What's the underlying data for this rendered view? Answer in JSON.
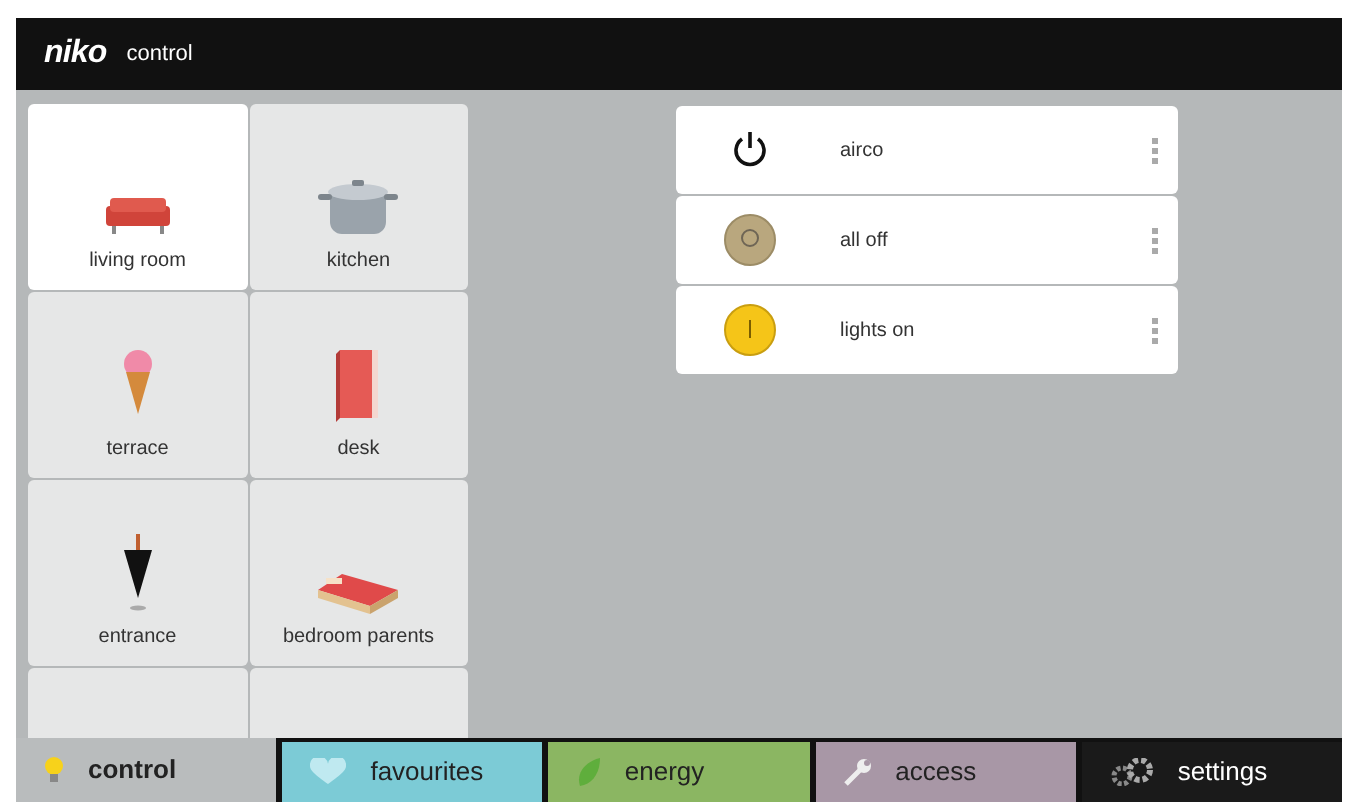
{
  "header": {
    "logo": "niko",
    "title": "control"
  },
  "rooms": [
    {
      "label": "living room",
      "kind": "sofa",
      "selected": true
    },
    {
      "label": "kitchen",
      "kind": "pot",
      "selected": false
    },
    {
      "label": "terrace",
      "kind": "icecream",
      "selected": false
    },
    {
      "label": "desk",
      "kind": "book",
      "selected": false
    },
    {
      "label": "entrance",
      "kind": "umbrella",
      "selected": false
    },
    {
      "label": "bedroom parents",
      "kind": "bed",
      "selected": false
    },
    {
      "kind": "empty",
      "selected": false
    },
    {
      "kind": "empty",
      "selected": false
    }
  ],
  "actions": [
    {
      "label": "airco",
      "kind": "power"
    },
    {
      "label": "all off",
      "kind": "off"
    },
    {
      "label": "lights on",
      "kind": "on"
    }
  ],
  "tabs": [
    {
      "label": "control",
      "kind": "bulb",
      "color": "#b9bcbd",
      "selected": true
    },
    {
      "label": "favourites",
      "kind": "heart",
      "color": "#7ccbd6",
      "selected": false
    },
    {
      "label": "energy",
      "kind": "leaf",
      "color": "#8bb662",
      "selected": false
    },
    {
      "label": "access",
      "kind": "wrench",
      "color": "#a897a6",
      "selected": false
    },
    {
      "label": "settings",
      "kind": "gears",
      "color": "#1a1a1a",
      "selected": false
    }
  ]
}
